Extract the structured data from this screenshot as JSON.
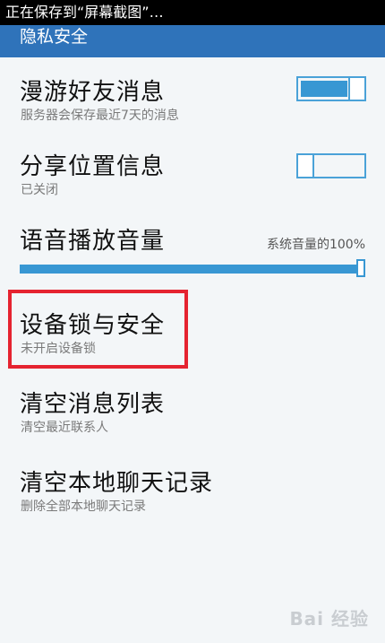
{
  "status_bar": {
    "text": "正在保存到“屏幕截图”…"
  },
  "header": {
    "title": "隐私安全"
  },
  "items": [
    {
      "title": "漫游好友消息",
      "subtitle": "服务器会保存最近7天的消息",
      "toggle_on": true
    },
    {
      "title": "分享位置信息",
      "subtitle": "已关闭",
      "toggle_on": false
    },
    {
      "title": "语音播放音量",
      "volume_label": "系统音量的100%",
      "volume_percent": 100
    },
    {
      "title": "设备锁与安全",
      "subtitle": "未开启设备锁"
    },
    {
      "title": "清空消息列表",
      "subtitle": "清空最近联系人"
    },
    {
      "title": "清空本地聊天记录",
      "subtitle": "删除全部本地聊天记录"
    }
  ],
  "colors": {
    "header": "#2f73ba",
    "accent": "#3897d3",
    "highlight_box": "#e52330"
  },
  "watermark": {
    "text": "Bai 经验"
  }
}
